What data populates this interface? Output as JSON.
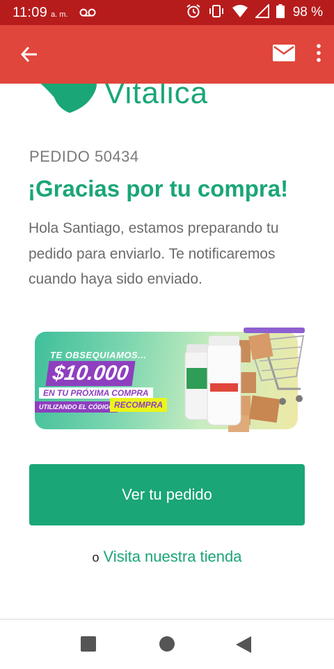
{
  "status_bar": {
    "time": "11:09",
    "ampm": "a. m.",
    "battery_percent": "98 %",
    "icons": [
      "voicemail-icon",
      "alarm-icon",
      "vibrate-icon",
      "wifi-icon",
      "signal-icon",
      "battery-icon"
    ]
  },
  "app_bar": {
    "icons": [
      "back-arrow-icon",
      "mail-icon",
      "more-vert-icon"
    ],
    "color": "#e0463b"
  },
  "email": {
    "brand_name": "Vitalica",
    "order_label": "PEDIDO 50434",
    "heading": "¡Gracias por tu compra!",
    "message": "Hola Santiago, estamos preparando tu pedido para enviarlo. Te notificaremos cuando haya sido enviado.",
    "promo": {
      "line1": "TE OBSEQUIAMOS...",
      "amount": "$10.000",
      "line2": "EN TU PRÓXIMA COMPRA",
      "line3": "UTILIZANDO EL CÓDIGO",
      "code": "RECOMPRA"
    },
    "cta_label": "Ver tu pedido",
    "store_prefix": "o",
    "store_link": "Visita nuestra tienda",
    "accent_color": "#1aa676"
  },
  "nav_bar": {
    "icons": [
      "recents-square-icon",
      "home-circle-icon",
      "back-triangle-icon"
    ]
  }
}
